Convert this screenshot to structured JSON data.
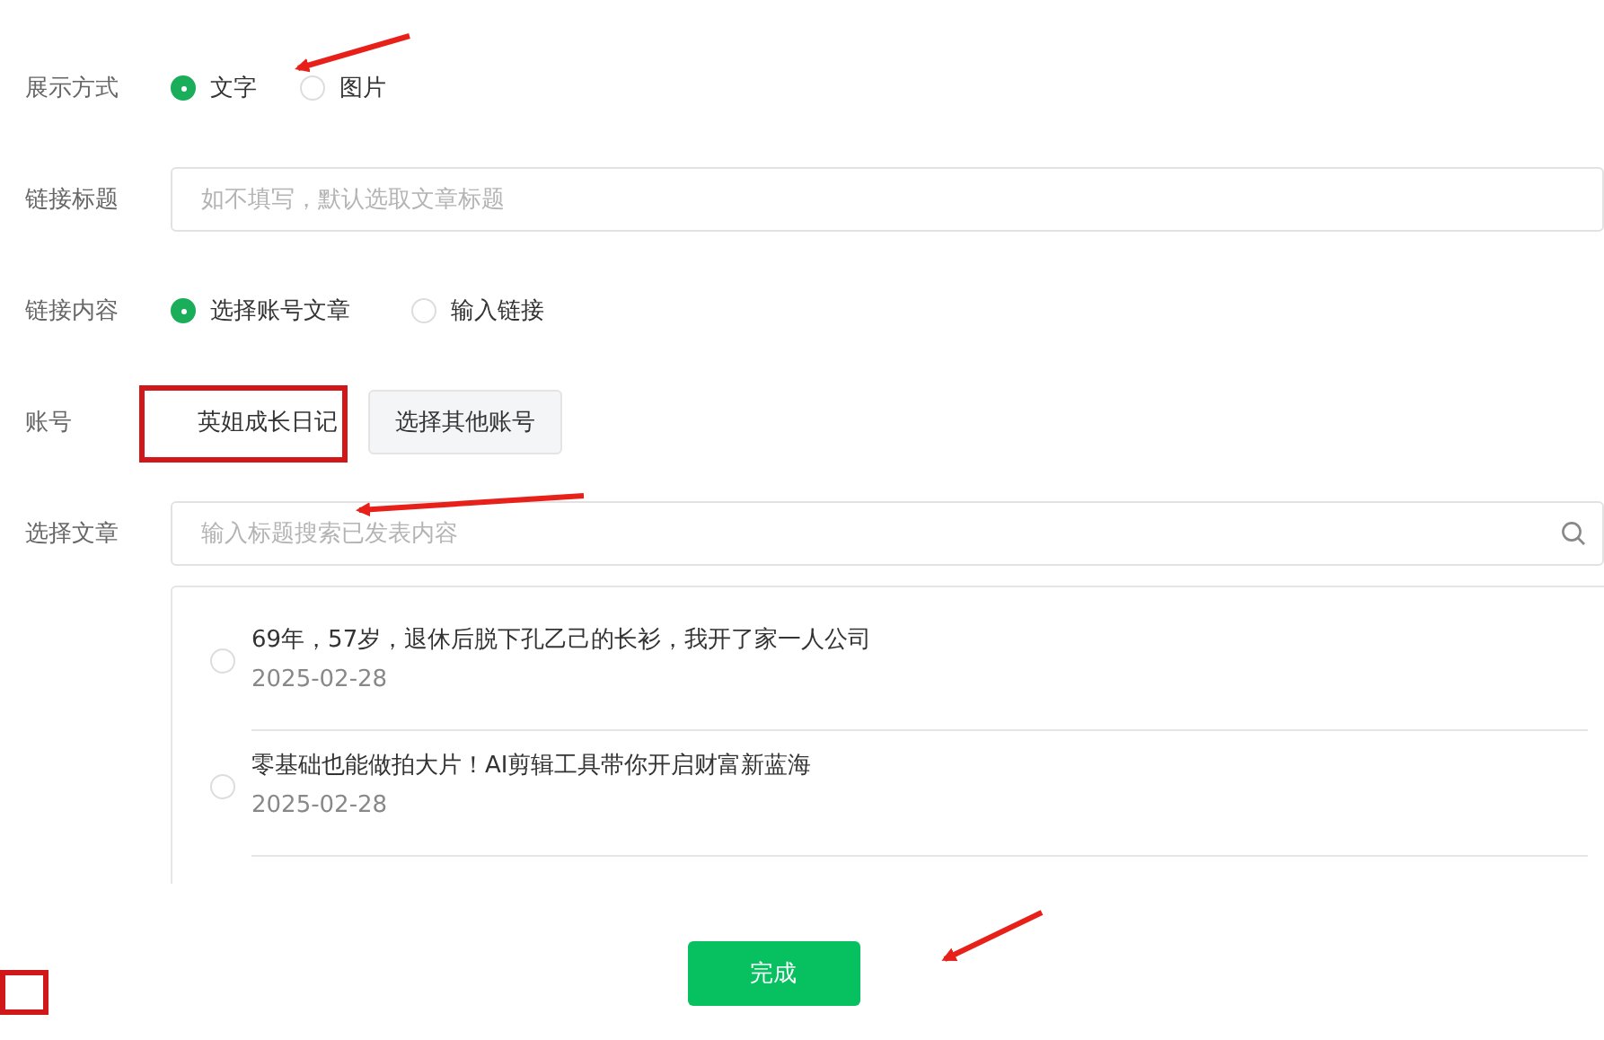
{
  "display_mode": {
    "label": "展示方式",
    "options": [
      {
        "label": "文字",
        "selected": true
      },
      {
        "label": "图片",
        "selected": false
      }
    ]
  },
  "link_title": {
    "label": "链接标题",
    "placeholder": "如不填写，默认选取文章标题"
  },
  "link_content": {
    "label": "链接内容",
    "options": [
      {
        "label": "选择账号文章",
        "selected": true
      },
      {
        "label": "输入链接",
        "selected": false
      }
    ]
  },
  "account": {
    "label": "账号",
    "current": "英姐成长日记",
    "other_button": "选择其他账号"
  },
  "select_article": {
    "label": "选择文章",
    "placeholder": "输入标题搜索已发表内容",
    "articles": [
      {
        "title": "69年，57岁，退休后脱下孔乙己的长衫，我开了家一人公司",
        "date": "2025-02-28",
        "selected": false
      },
      {
        "title": "零基础也能做拍大片！AI剪辑工具带你开启财富新蓝海",
        "date": "2025-02-28",
        "selected": false
      }
    ]
  },
  "done_button": "完成"
}
